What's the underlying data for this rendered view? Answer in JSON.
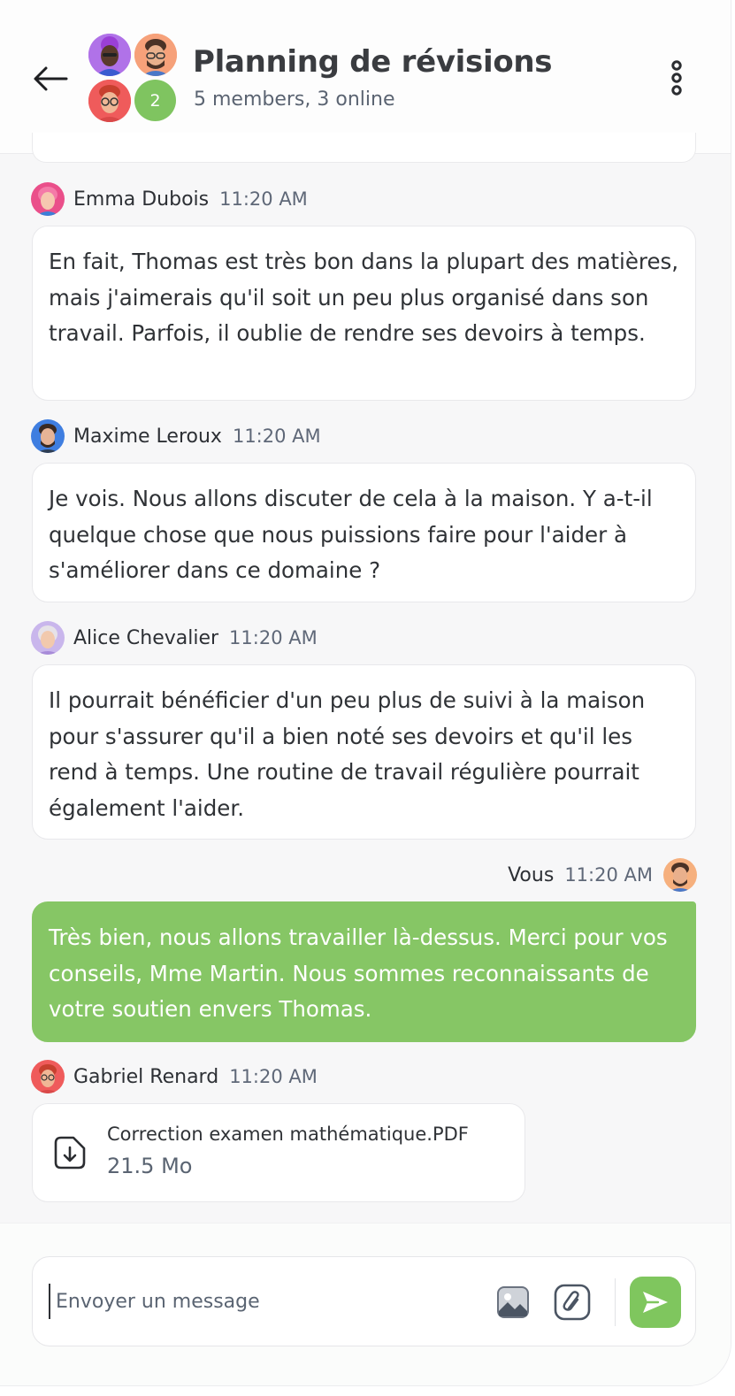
{
  "header": {
    "title": "Planning de révisions",
    "subtitle": "5 members, 3 online",
    "extra_members": "2"
  },
  "messages": [
    {
      "sender": "Emma Dubois",
      "time": "11:20 AM",
      "text": "En fait, Thomas est très bon dans la plupart des matières, mais j'aimerais qu'il soit un peu plus organisé dans son travail. Parfois, il oublie de rendre ses devoirs à temps."
    },
    {
      "sender": "Maxime Leroux",
      "time": "11:20 AM",
      "text": "Je vois. Nous allons discuter de cela à la maison. Y a-t-il quelque chose que nous puissions faire pour l'aider à s'améliorer dans ce domaine ?"
    },
    {
      "sender": "Alice Chevalier",
      "time": "11:20 AM",
      "text": " Il pourrait bénéficier d'un peu plus de suivi à la maison pour s'assurer qu'il a bien noté ses devoirs et qu'il les rend à temps. Une routine de travail régulière pourrait également l'aider."
    },
    {
      "sender": "Vous",
      "time": "11:20 AM",
      "text": "Très bien, nous allons travailler là-dessus. Merci pour vos conseils, Mme Martin. Nous sommes reconnaissants de votre soutien envers Thomas."
    },
    {
      "sender": "Gabriel Renard",
      "time": "11:20 AM",
      "file": {
        "name": "Correction examen mathématique.PDF",
        "size": "21.5 Mo"
      }
    }
  ],
  "composer": {
    "placeholder": "Envoyer un message",
    "value": ""
  },
  "colors": {
    "accent_green": "#86c665",
    "text_dark": "#2d3035",
    "text_muted": "#5f6878"
  },
  "icons": [
    "arrow-left-icon",
    "more-vertical-icon",
    "file-download-icon",
    "image-icon",
    "attachment-icon",
    "send-icon"
  ]
}
